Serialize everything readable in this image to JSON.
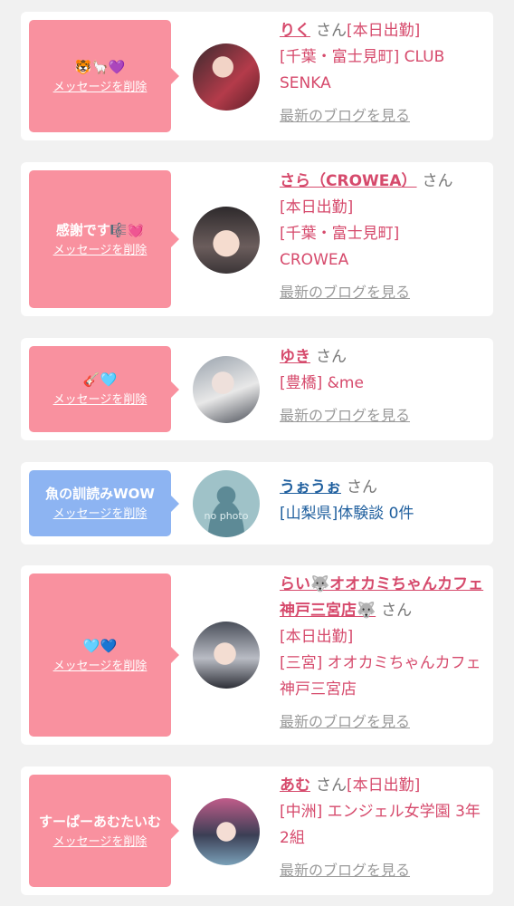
{
  "delete_label": "メッセージを削除",
  "san_label": "さん",
  "blog_label": "最新のブログを見る",
  "cards": [
    {
      "message": "🐯🦙💜",
      "name": "りく",
      "status": "[本日出勤]",
      "area": "[千葉・富士見町] CLUB SENKA"
    },
    {
      "message": "感謝です🎼💓",
      "name": "さら（CROWEA）",
      "status": "[本日出勤]",
      "area": "[千葉・富士見町] CROWEA"
    },
    {
      "message": "🎸🩵",
      "name": "ゆき",
      "status": "",
      "area": "[豊橋] &me"
    },
    {
      "message": "魚の訓読みWOW",
      "name": "うぉうぉ",
      "status": "",
      "area": "[山梨県]体験談 0件",
      "avatar_text": "no photo"
    },
    {
      "message": "🩵💙",
      "name": "らい🐺オオカミちゃんカフェ神戸三宮店🐺",
      "status": "[本日出勤]",
      "area": "[三宮] オオカミちゃんカフェ神戸三宮店"
    },
    {
      "message": "すーぱーあむたいむ",
      "name": "あむ",
      "status": "[本日出勤]",
      "area": "[中洲] エンジェル女学園 3年2組"
    }
  ],
  "colors": {
    "accent_pink": "#d64a6c",
    "message_pink": "#f9919f",
    "message_blue": "#8db4f2",
    "link_blue": "#1f5f9e"
  }
}
